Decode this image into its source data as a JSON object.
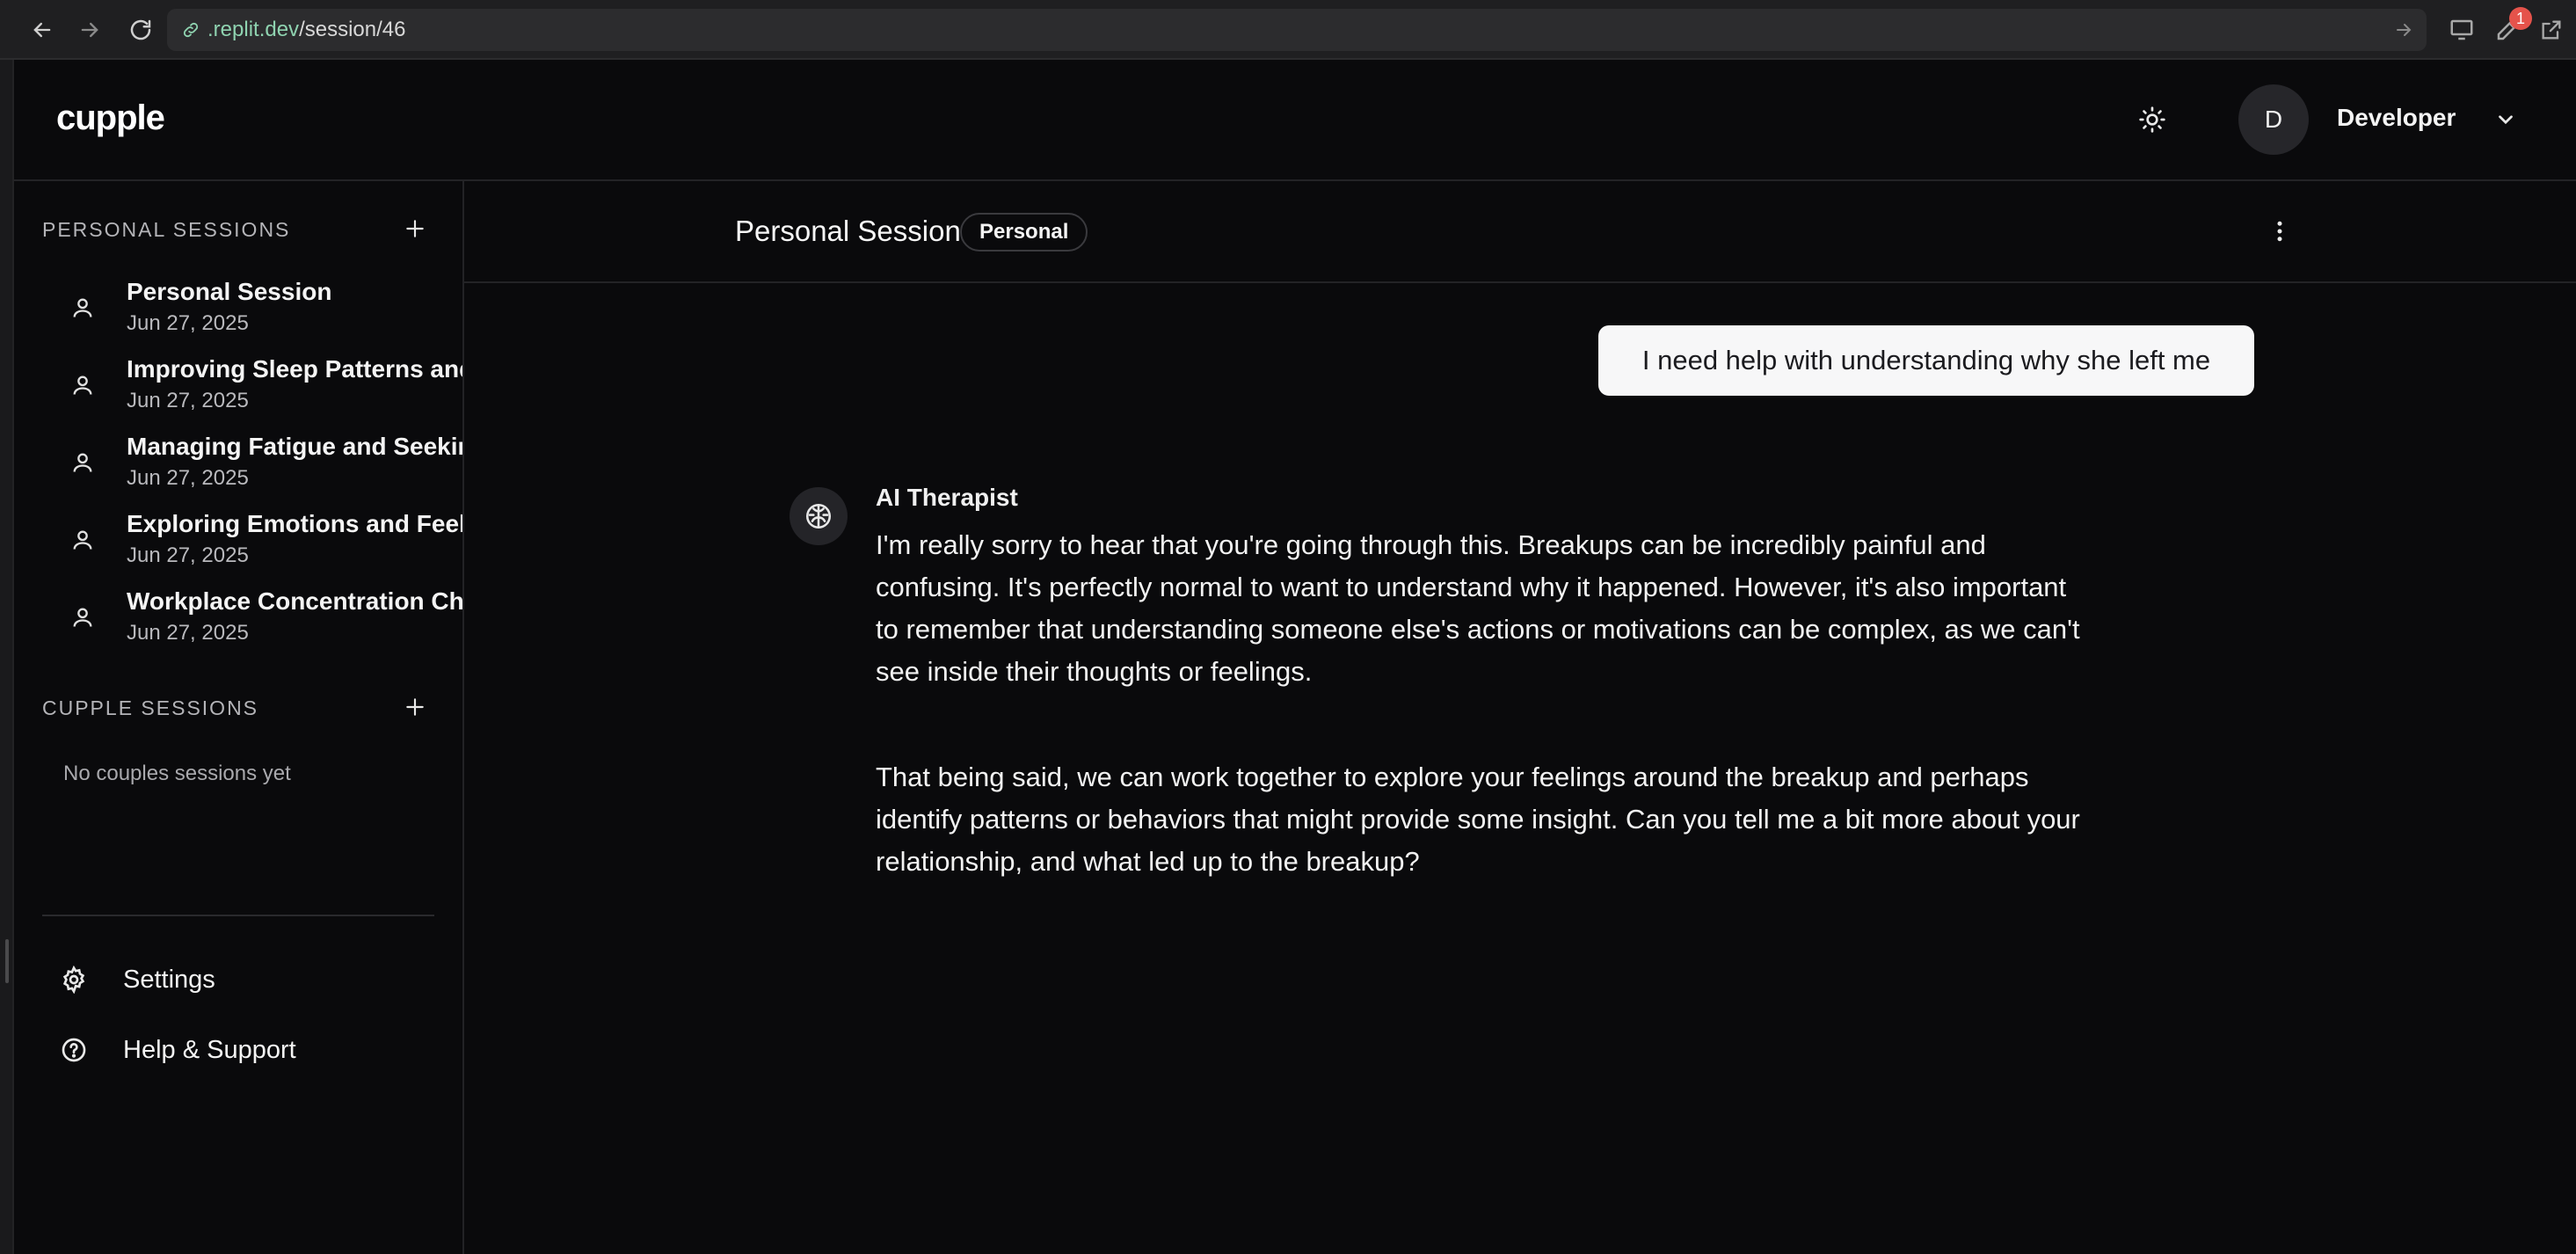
{
  "browser": {
    "url_host": ".replit.dev",
    "url_path": "/session/46",
    "notification_count": "1"
  },
  "header": {
    "logo": "cupple",
    "avatar_initial": "D",
    "user_name": "Developer"
  },
  "sidebar": {
    "personal_title": "PERSONAL SESSIONS",
    "personal_sessions": [
      {
        "title": "Personal Session",
        "date": "Jun 27, 2025"
      },
      {
        "title": "Improving Sleep Patterns and",
        "date": "Jun 27, 2025"
      },
      {
        "title": "Managing Fatigue and Seekin",
        "date": "Jun 27, 2025"
      },
      {
        "title": "Exploring Emotions and Feeli",
        "date": "Jun 27, 2025"
      },
      {
        "title": "Workplace Concentration Cha",
        "date": "Jun 27, 2025"
      }
    ],
    "cupple_title": "CUPPLE SESSIONS",
    "cupple_empty": "No couples sessions yet",
    "settings_label": "Settings",
    "help_label": "Help & Support"
  },
  "chat": {
    "title": "Personal Session",
    "tag": "Personal",
    "user_message": "I need help with understanding why she left me",
    "ai_name": "AI Therapist",
    "ai_paragraph_1": "I'm really sorry to hear that you're going through this. Breakups can be incredibly painful and confusing. It's perfectly normal to want to understand why it happened. However, it's also important to remember that understanding someone else's actions or motivations can be complex, as we can't see inside their thoughts or feelings.",
    "ai_paragraph_2": "That being said, we can work together to explore your feelings around the breakup and perhaps identify patterns or behaviors that might provide some insight. Can you tell me a bit more about your relationship, and what led up to the breakup?"
  },
  "icons": {
    "back": "arrow-left-icon",
    "forward": "arrow-right-icon",
    "reload": "reload-icon",
    "link": "link-icon",
    "theme": "sun-icon",
    "chevron": "chevron-down-icon",
    "add": "plus-icon",
    "session": "user-icon",
    "settings": "gear-icon",
    "help": "help-circle-icon",
    "more": "more-vertical-icon",
    "ai": "brain-icon"
  },
  "colors": {
    "background": "#0a0a0c",
    "user_bubble": "#f7f7f8",
    "badge": "#e5534b"
  }
}
